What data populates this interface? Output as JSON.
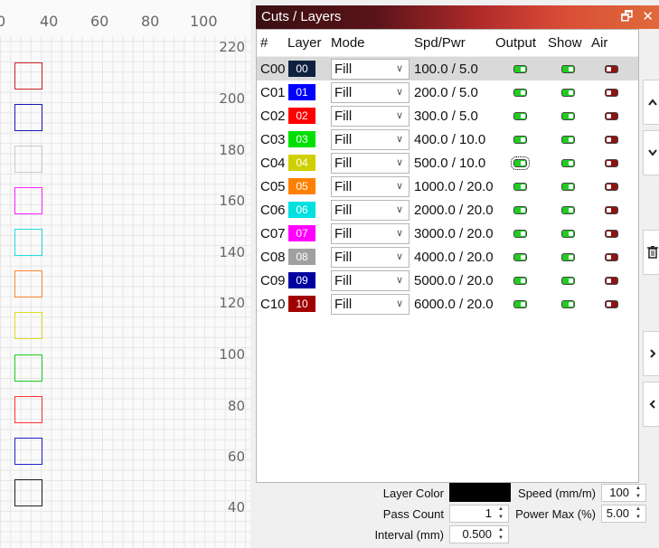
{
  "workspace": {
    "top_ruler": [
      "0",
      "40",
      "60",
      "80",
      "100"
    ],
    "left_ruler": [
      "220",
      "200",
      "180",
      "160",
      "140",
      "120",
      "100",
      "80",
      "60",
      "40"
    ],
    "swatch_colors": [
      "#cc2222",
      "#1a1ab8",
      "#cccccc",
      "#ff22ff",
      "#22dddd",
      "#ff8833",
      "#dddd22",
      "#22cc22",
      "#ff3333",
      "#2222cc",
      "#222222"
    ]
  },
  "panel": {
    "title": "Cuts / Layers",
    "restore_icon": "restore-icon",
    "close_icon": "close-icon",
    "columns": [
      "#",
      "Layer",
      "Mode",
      "Spd/Pwr",
      "Output",
      "Show",
      "Air"
    ],
    "rows": [
      {
        "num": "C00",
        "layer": "00",
        "color": "#102040",
        "mode": "Fill",
        "spd": "100.0 / 5.0",
        "output": true,
        "show": true,
        "air": false,
        "selected": true
      },
      {
        "num": "C01",
        "layer": "01",
        "color": "#0000ff",
        "mode": "Fill",
        "spd": "200.0 / 5.0",
        "output": true,
        "show": true,
        "air": false
      },
      {
        "num": "C02",
        "layer": "02",
        "color": "#ff0000",
        "mode": "Fill",
        "spd": "300.0 / 5.0",
        "output": true,
        "show": true,
        "air": false
      },
      {
        "num": "C03",
        "layer": "03",
        "color": "#00e000",
        "mode": "Fill",
        "spd": "400.0 / 10.0",
        "output": true,
        "show": true,
        "air": false
      },
      {
        "num": "C04",
        "layer": "04",
        "color": "#d0d000",
        "mode": "Fill",
        "spd": "500.0 / 10.0",
        "output": true,
        "show": true,
        "air": false,
        "focused": true
      },
      {
        "num": "C05",
        "layer": "05",
        "color": "#ff8000",
        "mode": "Fill",
        "spd": "1000.0 / 20.0",
        "output": true,
        "show": true,
        "air": false
      },
      {
        "num": "C06",
        "layer": "06",
        "color": "#00e0e0",
        "mode": "Fill",
        "spd": "2000.0 / 20.0",
        "output": true,
        "show": true,
        "air": false
      },
      {
        "num": "C07",
        "layer": "07",
        "color": "#ff00ff",
        "mode": "Fill",
        "spd": "3000.0 / 20.0",
        "output": true,
        "show": true,
        "air": false
      },
      {
        "num": "C08",
        "layer": "08",
        "color": "#a0a0a0",
        "mode": "Fill",
        "spd": "4000.0 / 20.0",
        "output": true,
        "show": true,
        "air": false
      },
      {
        "num": "C09",
        "layer": "09",
        "color": "#0000a0",
        "mode": "Fill",
        "spd": "5000.0 / 20.0",
        "output": true,
        "show": true,
        "air": false
      },
      {
        "num": "C10",
        "layer": "10",
        "color": "#a00000",
        "mode": "Fill",
        "spd": "6000.0 / 20.0",
        "output": true,
        "show": true,
        "air": false
      }
    ]
  },
  "side_buttons": [
    "chevron-up-icon",
    "chevron-down-icon",
    "trash-icon",
    "chevron-right-icon",
    "chevron-left-icon"
  ],
  "settings": {
    "layer_color_label": "Layer Color",
    "layer_color": "#000000",
    "pass_count_label": "Pass Count",
    "pass_count": "1",
    "interval_label": "Interval (mm)",
    "interval": "0.500",
    "speed_label": "Speed (mm/m)",
    "speed": "100",
    "power_max_label": "Power Max (%)",
    "power_max": "5.00"
  }
}
